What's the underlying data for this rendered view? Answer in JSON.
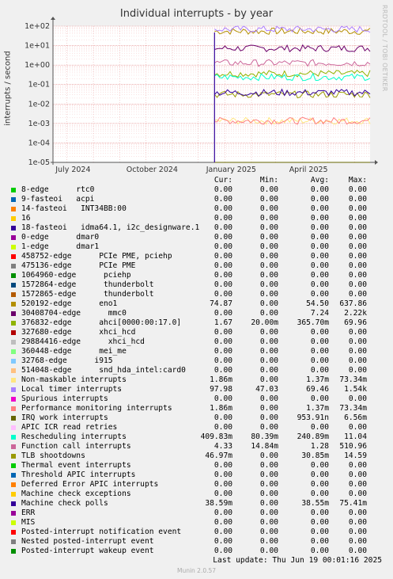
{
  "title": "Individual interrupts - by year",
  "watermark": "RRDTOOL / TOBI OETIKER",
  "footer": {
    "last_update": "Last update: Thu Jun 19 00:01:16 2025",
    "version": "Munin 2.0.57"
  },
  "chart_data": {
    "type": "line",
    "title": "Individual interrupts - by year",
    "ylabel": "interrupts / second",
    "yscale": "log",
    "ylim": [
      1e-05,
      100
    ],
    "yticks": [
      "1e-05",
      "1e-04",
      "1e-03",
      "1e-02",
      "1e-01",
      "1e+00",
      "1e+01",
      "1e+02"
    ],
    "xlim": [
      "2024-06-15",
      "2025-06-19"
    ],
    "xticks": [
      "July 2024",
      "October 2024",
      "January 2025",
      "April 2025"
    ],
    "data_start": "2024-12-20",
    "grid": true,
    "legend_columns": [
      "Cur:",
      "Min:",
      "Avg:",
      "Max:"
    ],
    "series": [
      {
        "name": "8-edge      rtc0",
        "color": "#00cc00",
        "cur": "0.00",
        "min": "0.00",
        "avg": "0.00",
        "max": "0.00"
      },
      {
        "name": "9-fasteoi   acpi",
        "color": "#0066b3",
        "cur": "0.00",
        "min": "0.00",
        "avg": "0.00",
        "max": "0.00"
      },
      {
        "name": "14-fasteoi   INT34BB:00",
        "color": "#ff8000",
        "cur": "0.00",
        "min": "0.00",
        "avg": "0.00",
        "max": "0.00"
      },
      {
        "name": "16",
        "color": "#ffcc00",
        "cur": "0.00",
        "min": "0.00",
        "avg": "0.00",
        "max": "0.00"
      },
      {
        "name": "18-fasteoi   idma64.1, i2c_designware.1",
        "color": "#330099",
        "cur": "0.00",
        "min": "0.00",
        "avg": "0.00",
        "max": "0.00"
      },
      {
        "name": "0-edge      dmar0",
        "color": "#990099",
        "cur": "0.00",
        "min": "0.00",
        "avg": "0.00",
        "max": "0.00"
      },
      {
        "name": "1-edge      dmar1",
        "color": "#ccff00",
        "cur": "0.00",
        "min": "0.00",
        "avg": "0.00",
        "max": "0.00"
      },
      {
        "name": "458752-edge      PCIe PME, pciehp",
        "color": "#ff0000",
        "cur": "0.00",
        "min": "0.00",
        "avg": "0.00",
        "max": "0.00"
      },
      {
        "name": "475136-edge      PCIe PME",
        "color": "#808080",
        "cur": "0.00",
        "min": "0.00",
        "avg": "0.00",
        "max": "0.00"
      },
      {
        "name": "1064960-edge      pciehp",
        "color": "#008f00",
        "cur": "0.00",
        "min": "0.00",
        "avg": "0.00",
        "max": "0.00"
      },
      {
        "name": "1572864-edge      thunderbolt",
        "color": "#00487d",
        "cur": "0.00",
        "min": "0.00",
        "avg": "0.00",
        "max": "0.00"
      },
      {
        "name": "1572865-edge      thunderbolt",
        "color": "#b35a00",
        "cur": "0.00",
        "min": "0.00",
        "avg": "0.00",
        "max": "0.00"
      },
      {
        "name": "520192-edge      eno1",
        "color": "#b38f00",
        "cur": "74.87",
        "min": "0.00",
        "avg": "54.50",
        "max": "637.86"
      },
      {
        "name": "30408704-edge      mmc0",
        "color": "#6b006b",
        "cur": "0.00",
        "min": "0.00",
        "avg": "7.24",
        "max": "2.22k"
      },
      {
        "name": "376832-edge      ahci[0000:00:17.0]",
        "color": "#8fb300",
        "cur": "1.67",
        "min": "20.00m",
        "avg": "365.70m",
        "max": "69.96"
      },
      {
        "name": "327680-edge      xhci_hcd",
        "color": "#b30000",
        "cur": "0.00",
        "min": "0.00",
        "avg": "0.00",
        "max": "0.00"
      },
      {
        "name": "29884416-edge      xhci_hcd",
        "color": "#bebebe",
        "cur": "0.00",
        "min": "0.00",
        "avg": "0.00",
        "max": "0.00"
      },
      {
        "name": "360448-edge      mei_me",
        "color": "#80ff80",
        "cur": "0.00",
        "min": "0.00",
        "avg": "0.00",
        "max": "0.00"
      },
      {
        "name": "32768-edge      i915",
        "color": "#80c9ff",
        "cur": "0.00",
        "min": "0.00",
        "avg": "0.00",
        "max": "0.00"
      },
      {
        "name": "514048-edge      snd_hda_intel:card0",
        "color": "#ffc080",
        "cur": "0.00",
        "min": "0.00",
        "avg": "0.00",
        "max": "0.00"
      },
      {
        "name": "Non-maskable interrupts",
        "color": "#ffe680",
        "cur": "1.86m",
        "min": "0.00",
        "avg": "1.37m",
        "max": "73.34m"
      },
      {
        "name": "Local timer interrupts",
        "color": "#aa80ff",
        "cur": "97.98",
        "min": "47.03",
        "avg": "69.46",
        "max": "1.54k"
      },
      {
        "name": "Spurious interrupts",
        "color": "#ee00cc",
        "cur": "0.00",
        "min": "0.00",
        "avg": "0.00",
        "max": "0.00"
      },
      {
        "name": "Performance monitoring interrupts",
        "color": "#ff8080",
        "cur": "1.86m",
        "min": "0.00",
        "avg": "1.37m",
        "max": "73.34m"
      },
      {
        "name": "IRQ work interrupts",
        "color": "#666600",
        "cur": "0.00",
        "min": "0.00",
        "avg": "953.91n",
        "max": "6.56m"
      },
      {
        "name": "APIC ICR read retries",
        "color": "#ffbfff",
        "cur": "0.00",
        "min": "0.00",
        "avg": "0.00",
        "max": "0.00"
      },
      {
        "name": "Rescheduling interrupts",
        "color": "#00ffcc",
        "cur": "409.83m",
        "min": "80.39m",
        "avg": "240.89m",
        "max": "11.04"
      },
      {
        "name": "Function call interrupts",
        "color": "#cc6699",
        "cur": "4.33",
        "min": "14.84m",
        "avg": "1.28",
        "max": "510.96"
      },
      {
        "name": "TLB shootdowns",
        "color": "#999900",
        "cur": "46.97m",
        "min": "0.00",
        "avg": "30.85m",
        "max": "14.59"
      },
      {
        "name": "Thermal event interrupts",
        "color": "#00cc00",
        "cur": "0.00",
        "min": "0.00",
        "avg": "0.00",
        "max": "0.00"
      },
      {
        "name": "Threshold APIC interrupts",
        "color": "#0066b3",
        "cur": "0.00",
        "min": "0.00",
        "avg": "0.00",
        "max": "0.00"
      },
      {
        "name": "Deferred Error APIC interrupts",
        "color": "#ff8000",
        "cur": "0.00",
        "min": "0.00",
        "avg": "0.00",
        "max": "0.00"
      },
      {
        "name": "Machine check exceptions",
        "color": "#ffcc00",
        "cur": "0.00",
        "min": "0.00",
        "avg": "0.00",
        "max": "0.00"
      },
      {
        "name": "Machine check polls",
        "color": "#330099",
        "cur": "38.59m",
        "min": "0.00",
        "avg": "38.55m",
        "max": "75.41m"
      },
      {
        "name": "ERR",
        "color": "#990099",
        "cur": "0.00",
        "min": "0.00",
        "avg": "0.00",
        "max": "0.00"
      },
      {
        "name": "MIS",
        "color": "#ccff00",
        "cur": "0.00",
        "min": "0.00",
        "avg": "0.00",
        "max": "0.00"
      },
      {
        "name": "Posted-interrupt notification event",
        "color": "#ff0000",
        "cur": "0.00",
        "min": "0.00",
        "avg": "0.00",
        "max": "0.00"
      },
      {
        "name": "Nested posted-interrupt event",
        "color": "#808080",
        "cur": "0.00",
        "min": "0.00",
        "avg": "0.00",
        "max": "0.00"
      },
      {
        "name": "Posted-interrupt wakeup event",
        "color": "#008f00",
        "cur": "0.00",
        "min": "0.00",
        "avg": "0.00",
        "max": "0.00"
      }
    ]
  }
}
